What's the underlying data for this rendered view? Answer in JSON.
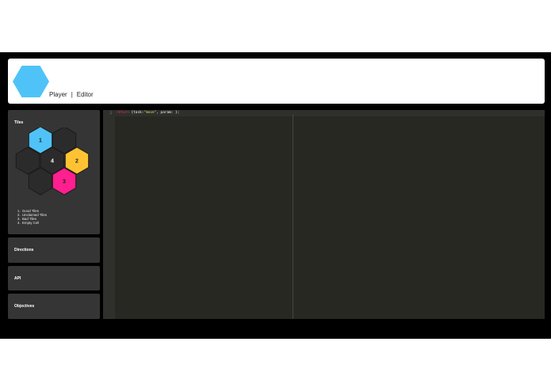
{
  "header": {
    "nav": {
      "player": "Player",
      "separator": "|",
      "editor": "Editor"
    }
  },
  "sidebar": {
    "tiles_title": "Tiles",
    "tiles": [
      {
        "label": "1",
        "color": "#4fc3f7"
      },
      {
        "label": "",
        "color": "#2b2b2b"
      },
      {
        "label": "",
        "color": "#2b2b2b"
      },
      {
        "label": "4",
        "color": "#2b2b2b"
      },
      {
        "label": "2",
        "color": "#ffc233"
      },
      {
        "label": "",
        "color": "#2b2b2b"
      },
      {
        "label": "3",
        "color": "#ff1f8e"
      }
    ],
    "legend": [
      {
        "num": "1.",
        "text": "Good Tiles"
      },
      {
        "num": "2.",
        "text": "Unclaimed Tiles"
      },
      {
        "num": "3.",
        "text": "Bad Tiles"
      },
      {
        "num": "4.",
        "text": "Empty Cell"
      }
    ],
    "sections": [
      "Directions",
      "API",
      "Objectives"
    ]
  },
  "editor": {
    "line_number": "1",
    "code": {
      "keyword": "return",
      "part1": " {task:",
      "string": "\"move\"",
      "part2": ", param: ",
      "part3": "};"
    }
  },
  "colors": {
    "logo": "#4fc3f7",
    "good_tile": "#4fc3f7",
    "unclaimed_tile": "#ffc233",
    "bad_tile": "#ff1f8e",
    "editor_bg": "#272822"
  }
}
